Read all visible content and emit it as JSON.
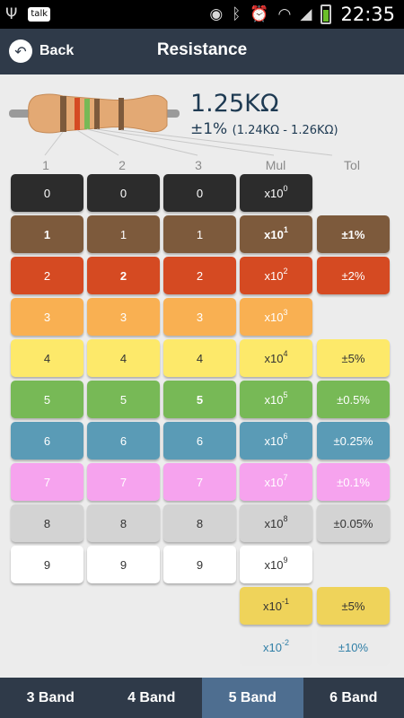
{
  "status_bar": {
    "left_icons": [
      "usb-icon",
      "talk-icon"
    ],
    "talk_label": "talk",
    "right_icons": [
      "eye-icon",
      "bluetooth-icon",
      "alarm-icon",
      "wifi-icon",
      "signal-icon",
      "battery-icon"
    ],
    "time": "22:35"
  },
  "header": {
    "back_label": "Back",
    "title": "Resistance"
  },
  "result": {
    "value": "1.25KΩ",
    "tolerance": "±1%",
    "range": "(1.24KΩ - 1.26KΩ)"
  },
  "columns": [
    "1",
    "2",
    "3",
    "Mul",
    "Tol"
  ],
  "colors": {
    "black": "#2c2c2c",
    "brown": "#7d5a3c",
    "red": "#d54a22",
    "orange": "#f9b052",
    "yellow": "#fde96a",
    "green": "#77b956",
    "blue": "#5a9bb6",
    "violet": "#f6a3ee",
    "gray": "#d3d3d3",
    "white": "#ffffff",
    "gold": "#efd35a",
    "silver": "#ebebeb",
    "tab_bar": "#2f3a49",
    "tab_active": "#4e6e90"
  },
  "digit_rows": [
    {
      "label": "0",
      "mul_base": "x10",
      "mul_exp": "0",
      "tol": ""
    },
    {
      "label": "1",
      "mul_base": "x10",
      "mul_exp": "1",
      "tol": "±1%"
    },
    {
      "label": "2",
      "mul_base": "x10",
      "mul_exp": "2",
      "tol": "±2%"
    },
    {
      "label": "3",
      "mul_base": "x10",
      "mul_exp": "3",
      "tol": ""
    },
    {
      "label": "4",
      "mul_base": "x10",
      "mul_exp": "4",
      "tol": "±5%"
    },
    {
      "label": "5",
      "mul_base": "x10",
      "mul_exp": "5",
      "tol": "±0.5%"
    },
    {
      "label": "6",
      "mul_base": "x10",
      "mul_exp": "6",
      "tol": "±0.25%"
    },
    {
      "label": "7",
      "mul_base": "x10",
      "mul_exp": "7",
      "tol": "±0.1%"
    },
    {
      "label": "8",
      "mul_base": "x10",
      "mul_exp": "8",
      "tol": "±0.05%"
    },
    {
      "label": "9",
      "mul_base": "x10",
      "mul_exp": "9",
      "tol": ""
    }
  ],
  "extra_rows": [
    {
      "mul_base": "x10",
      "mul_exp": "-1",
      "tol": "±5%"
    },
    {
      "mul_base": "x10",
      "mul_exp": "-2",
      "tol": "±10%"
    }
  ],
  "selected": {
    "band1": "1",
    "band2": "2",
    "band3": "5",
    "mul": "1",
    "tol": "1"
  },
  "tabs": [
    {
      "label": "3 Band",
      "active": false
    },
    {
      "label": "4 Band",
      "active": false
    },
    {
      "label": "5 Band",
      "active": true
    },
    {
      "label": "6 Band",
      "active": false
    }
  ]
}
